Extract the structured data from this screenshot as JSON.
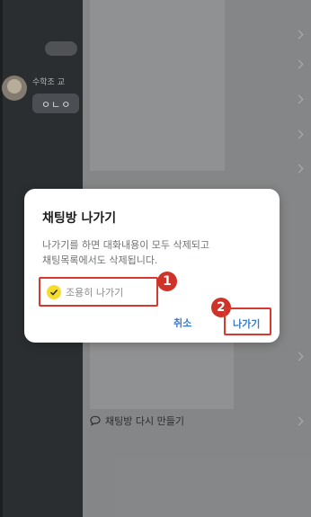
{
  "background": {
    "chat_name": "수학조 교",
    "chat_bubble": "ㅇㄴㅇ",
    "recreate_label": "채팅방 다시 만들기"
  },
  "dialog": {
    "title": "채팅방 나가기",
    "message": "나가기를 하면 대화내용이 모두 삭제되고\n채팅목록에서도 삭제됩니다.",
    "checkbox_label": "조용히 나가기",
    "checkbox_checked": true,
    "cancel_label": "취소",
    "leave_label": "나가기",
    "badge_1": "1",
    "badge_2": "2"
  },
  "colors": {
    "accent_yellow": "#f6dd2b",
    "highlight_red": "#d6392f",
    "button_blue": "#3b7bc7"
  }
}
